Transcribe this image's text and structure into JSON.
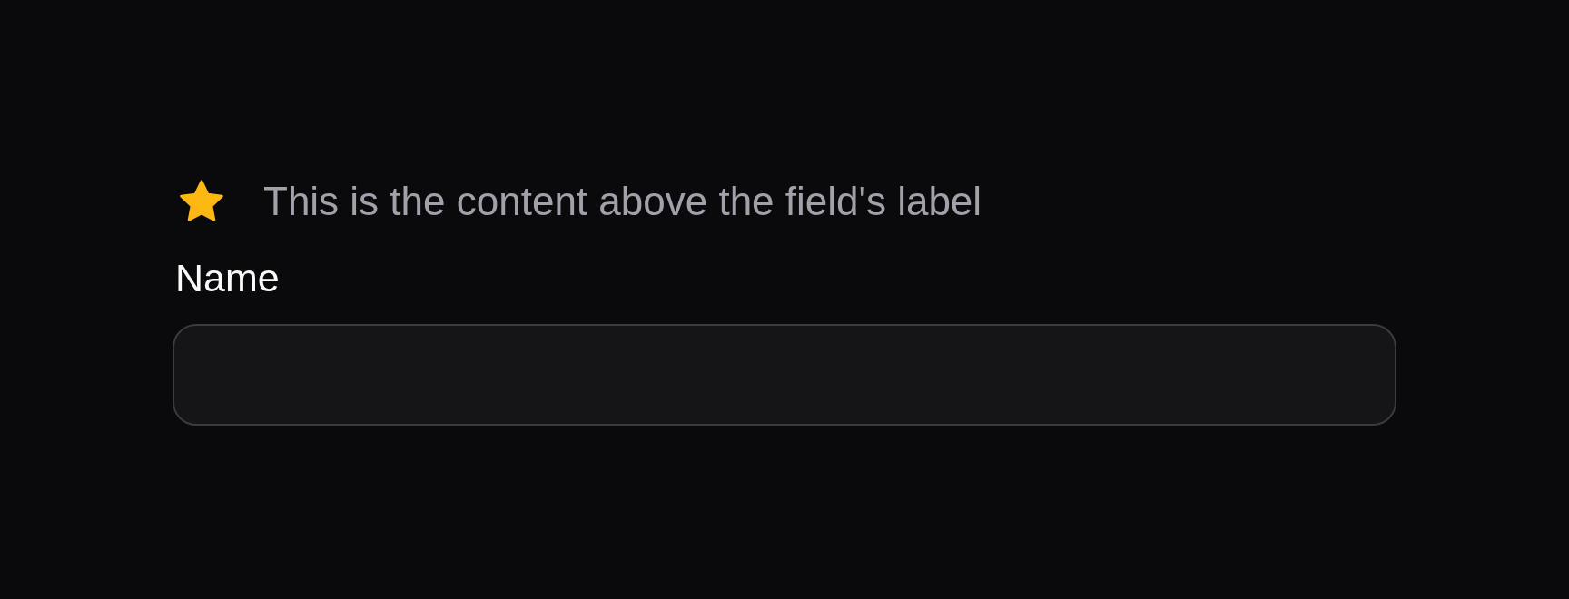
{
  "header": {
    "text": "This is the content above the field's label"
  },
  "field": {
    "label": "Name"
  }
}
